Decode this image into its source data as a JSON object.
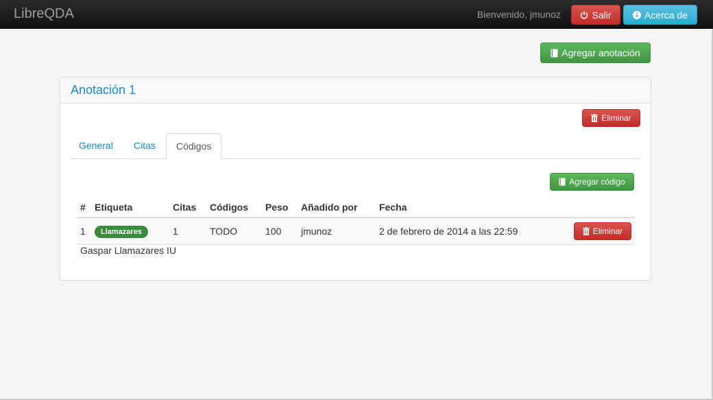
{
  "navbar": {
    "brand": "LibreQDA",
    "welcome": "Bienvenido, jmunoz",
    "logout_label": "Salir",
    "about_label": "Acerca de"
  },
  "toolbar": {
    "add_annotation_label": "Agregar anotación"
  },
  "panel": {
    "title": "Anotación 1",
    "delete_label": "Eliminar",
    "tabs": [
      {
        "label": "General",
        "active": false
      },
      {
        "label": "Citas",
        "active": false
      },
      {
        "label": "Códigos",
        "active": true
      }
    ],
    "add_code_label": "Agregar código",
    "table": {
      "headers": [
        "#",
        "Etiqueta",
        "Citas",
        "Códigos",
        "Peso",
        "Añadido por",
        "Fecha",
        ""
      ],
      "rows": [
        {
          "num": "1",
          "tag": "Llamazares",
          "citas": "1",
          "codigos": "TODO",
          "peso": "100",
          "added_by": "jmunoz",
          "fecha": "2 de febrero de 2014 a las 22:59",
          "delete_label": "Eliminar"
        }
      ]
    },
    "note": "Gaspar Llamazares IU"
  },
  "colors": {
    "danger": "#d9534f",
    "info": "#5bc0de",
    "success": "#5cb85c",
    "link": "#1a8bc7",
    "tag": "#3c8b3c"
  }
}
